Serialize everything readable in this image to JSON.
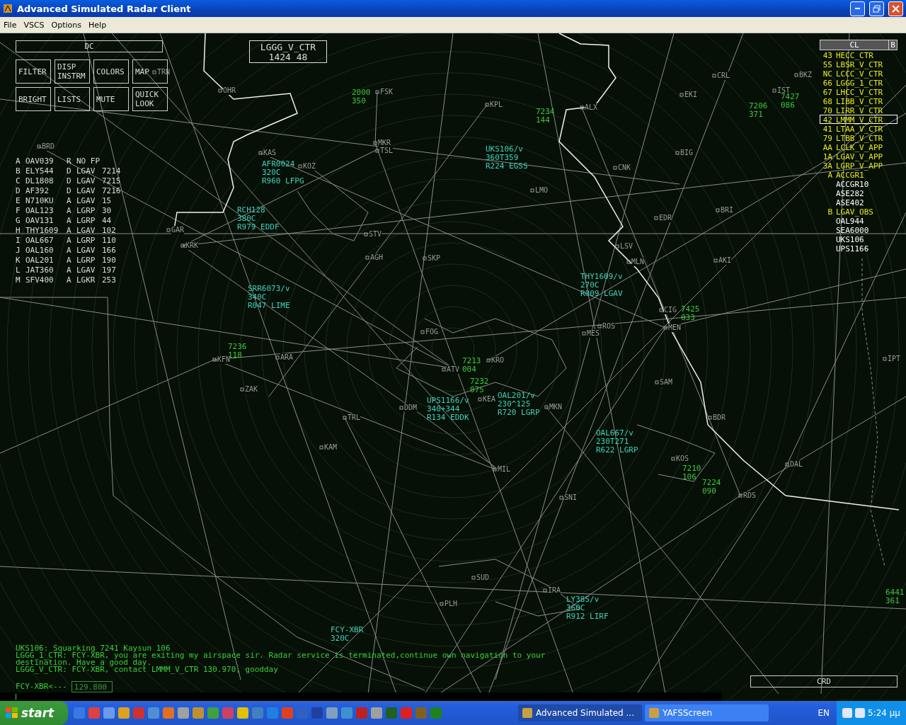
{
  "window": {
    "title": "Advanced Simulated Radar Client"
  },
  "menu": [
    "File",
    "VSCS",
    "Options",
    "Help"
  ],
  "display_control": {
    "title": "DC",
    "buttons": [
      "FILTER",
      "DISP INSTRM",
      "COLORS",
      "MAP",
      "BRIGHT",
      "LISTS",
      "MUTE",
      "QUICK LOOK"
    ]
  },
  "sector": {
    "name": "LGGG_V_CTR",
    "code": "1424 48"
  },
  "aircraft_list": [
    {
      "letter": "A",
      "callsign": "OAV039",
      "type": "R",
      "airport": "NO FP"
    },
    {
      "letter": "B",
      "callsign": "ELY544",
      "type": "D",
      "airport": "LGAV",
      "info": "7214"
    },
    {
      "letter": "C",
      "callsign": "DL1808",
      "type": "D",
      "airport": "LGAV",
      "info": "7215"
    },
    {
      "letter": "D",
      "callsign": "AF392",
      "type": "D",
      "airport": "LGAV",
      "info": "7216"
    },
    {
      "letter": "E",
      "callsign": "N710KU",
      "type": "A",
      "airport": "LGAV",
      "info": "15"
    },
    {
      "letter": "F",
      "callsign": "OAL123",
      "type": "A",
      "airport": "LGRP",
      "info": "30"
    },
    {
      "letter": "G",
      "callsign": "OAV131",
      "type": "A",
      "airport": "LGRP",
      "info": "44"
    },
    {
      "letter": "H",
      "callsign": "THY1609",
      "type": "A",
      "airport": "LGAV",
      "info": "102"
    },
    {
      "letter": "I",
      "callsign": "OAL667",
      "type": "A",
      "airport": "LGRP",
      "info": "110"
    },
    {
      "letter": "J",
      "callsign": "OAL160",
      "type": "A",
      "airport": "LGAV",
      "info": "166"
    },
    {
      "letter": "K",
      "callsign": "OAL201",
      "type": "A",
      "airport": "LGRP",
      "info": "190"
    },
    {
      "letter": "L",
      "callsign": "JAT360",
      "type": "A",
      "airport": "LGAV",
      "info": "197"
    },
    {
      "letter": "M",
      "callsign": "SFV400",
      "type": "A",
      "airport": "LGKR",
      "info": "253"
    }
  ],
  "controller_list": {
    "title": "CL",
    "button": "B",
    "items": [
      {
        "code": "43",
        "name": "HECC_CTR",
        "color": "#e8e820",
        "selected": false
      },
      {
        "code": "55",
        "name": "LBSR_V_CTR",
        "color": "#e8e820",
        "selected": false
      },
      {
        "code": "NC",
        "name": "LCCC_V_CTR",
        "color": "#e8e820",
        "selected": false
      },
      {
        "code": "66",
        "name": "LGGG_1_CTR",
        "color": "#e8e820",
        "selected": false
      },
      {
        "code": "67",
        "name": "LHCC_V_CTR",
        "color": "#e8e820",
        "selected": false
      },
      {
        "code": "68",
        "name": "LIBB_V_CTR",
        "color": "#e8e820",
        "selected": false
      },
      {
        "code": "70",
        "name": "LIRR_V_CTR",
        "color": "#e8e820",
        "selected": false
      },
      {
        "code": "42",
        "name": "LMMM_V_CTR",
        "color": "#e8e820",
        "selected": true
      },
      {
        "code": "41",
        "name": "LTAA_V_CTR",
        "color": "#e8e820",
        "selected": false
      },
      {
        "code": "79",
        "name": "LTBB_V_CTR",
        "color": "#e8e820",
        "selected": false
      },
      {
        "code": "AA",
        "name": "LCLK_V_APP",
        "color": "#e8e820",
        "selected": false
      },
      {
        "code": "1A",
        "name": "LGAV_V_APP",
        "color": "#e8e820",
        "selected": false
      },
      {
        "code": "3A",
        "name": "LGRP_V_APP",
        "color": "#e8e820",
        "selected": false
      },
      {
        "code": "A",
        "name": "ACCGR1",
        "color": "#e8e820",
        "selected": false
      },
      {
        "name": "ACCGR10",
        "color": "#ffffff",
        "selected": false
      },
      {
        "name": "ASE282",
        "color": "#ffffff",
        "selected": false
      },
      {
        "name": "ASE402",
        "color": "#ffffff",
        "selected": false
      },
      {
        "code": "B",
        "name": "LGAV_OBS",
        "color": "#e8e820",
        "selected": false
      },
      {
        "name": "OAL944",
        "color": "#ffffff",
        "selected": false
      },
      {
        "name": "SEA6000",
        "color": "#ffffff",
        "selected": false
      },
      {
        "name": "UKS106",
        "color": "#ffffff",
        "selected": false
      },
      {
        "name": "UPS1166",
        "color": "#ffffff",
        "selected": false
      }
    ]
  },
  "fixes": [
    "BRD",
    "TRN",
    "OHR",
    "FSK",
    "KPL",
    "ALX",
    "EKI",
    "CRL",
    "BKZ",
    "IST",
    "KAS",
    "KOZ",
    "MKR",
    "TSL",
    "BIG",
    "CNK",
    "LMO",
    "BRI",
    "EDR",
    "GAR",
    "KRK",
    "STV",
    "AGH",
    "SKP",
    "LSV",
    "MLN",
    "AKI",
    "CIG",
    "MEN",
    "ROS",
    "MES",
    "FOG",
    "KRO",
    "ATV",
    "KFN",
    "ARA",
    "ZAK",
    "DDM",
    "KEA",
    "MKN",
    "TRL",
    "KAM",
    "SAM",
    "BDR",
    "MIL",
    "SNI",
    "KOS",
    "RDS",
    "DAL",
    "IPT",
    "SUD",
    "IRA",
    "PLH"
  ],
  "targets": [
    {
      "kind": "untracked",
      "lines": [
        "2000",
        "350"
      ]
    },
    {
      "kind": "untracked",
      "lines": [
        "7234",
        "144"
      ]
    },
    {
      "kind": "untracked",
      "lines": [
        "7206",
        "371"
      ]
    },
    {
      "kind": "untracked",
      "lines": [
        "7427",
        "086"
      ]
    },
    {
      "kind": "tracked",
      "lines": [
        "UKS106/v",
        "360T359",
        "R224 EGSS"
      ]
    },
    {
      "kind": "tracked",
      "lines": [
        "AFR0024",
        "320C",
        "R960 LFPG"
      ]
    },
    {
      "kind": "tracked",
      "lines": [
        "RCH128",
        "380C",
        "R979 EDDF"
      ]
    },
    {
      "kind": "tracked",
      "lines": [
        "SRR6073/v",
        "340C",
        "R047 LIME"
      ]
    },
    {
      "kind": "tracked",
      "lines": [
        "THY1609/v",
        "270C",
        "R009 LGAV"
      ]
    },
    {
      "kind": "untracked",
      "lines": [
        "7425",
        "033"
      ]
    },
    {
      "kind": "untracked",
      "lines": [
        "7236",
        "118"
      ]
    },
    {
      "kind": "untracked",
      "lines": [
        "7213",
        "004"
      ]
    },
    {
      "kind": "untracked",
      "lines": [
        "7232",
        "075"
      ]
    },
    {
      "kind": "tracked",
      "lines": [
        "UPS1166/v",
        "340+344",
        "R134 EDDK"
      ]
    },
    {
      "kind": "tracked",
      "lines": [
        "OAL201/v",
        "230^125",
        "R720 LGRP"
      ]
    },
    {
      "kind": "tracked",
      "lines": [
        "OAL667/v",
        "230T271",
        "R622 LGRP"
      ]
    },
    {
      "kind": "untracked",
      "lines": [
        "7210",
        "106"
      ]
    },
    {
      "kind": "untracked",
      "lines": [
        "7224",
        "090"
      ]
    },
    {
      "kind": "tracked",
      "lines": [
        "LY385/v",
        "360C",
        "R912 LIRF"
      ]
    },
    {
      "kind": "untracked",
      "lines": [
        "6441",
        "361"
      ]
    },
    {
      "kind": "tracked",
      "lines": [
        "FCY-XBR",
        "320C"
      ]
    }
  ],
  "messages": [
    "UKS106: Squarking 7241 Kaysun 106",
    "LGGG_1_CTR: FCY-XBR, you are exiting my airspace sir. Radar service is terminated,continue own navigation to your destination. Have a good day.",
    "LGGG_V_CTR: FCY-XBR, contact LMMM_V_CTR 130.970, goodday"
  ],
  "input": {
    "callsign": "FCY-XBR<---",
    "frequency": "129.800"
  },
  "crd": {
    "label": "CRD"
  },
  "taskbar": {
    "start": "start",
    "tasks": [
      {
        "label": "Advanced Simulated ...",
        "selected": true
      },
      {
        "label": "YAFSScreen",
        "selected": false
      }
    ],
    "language": "EN",
    "clock": "5:24 μμ"
  }
}
